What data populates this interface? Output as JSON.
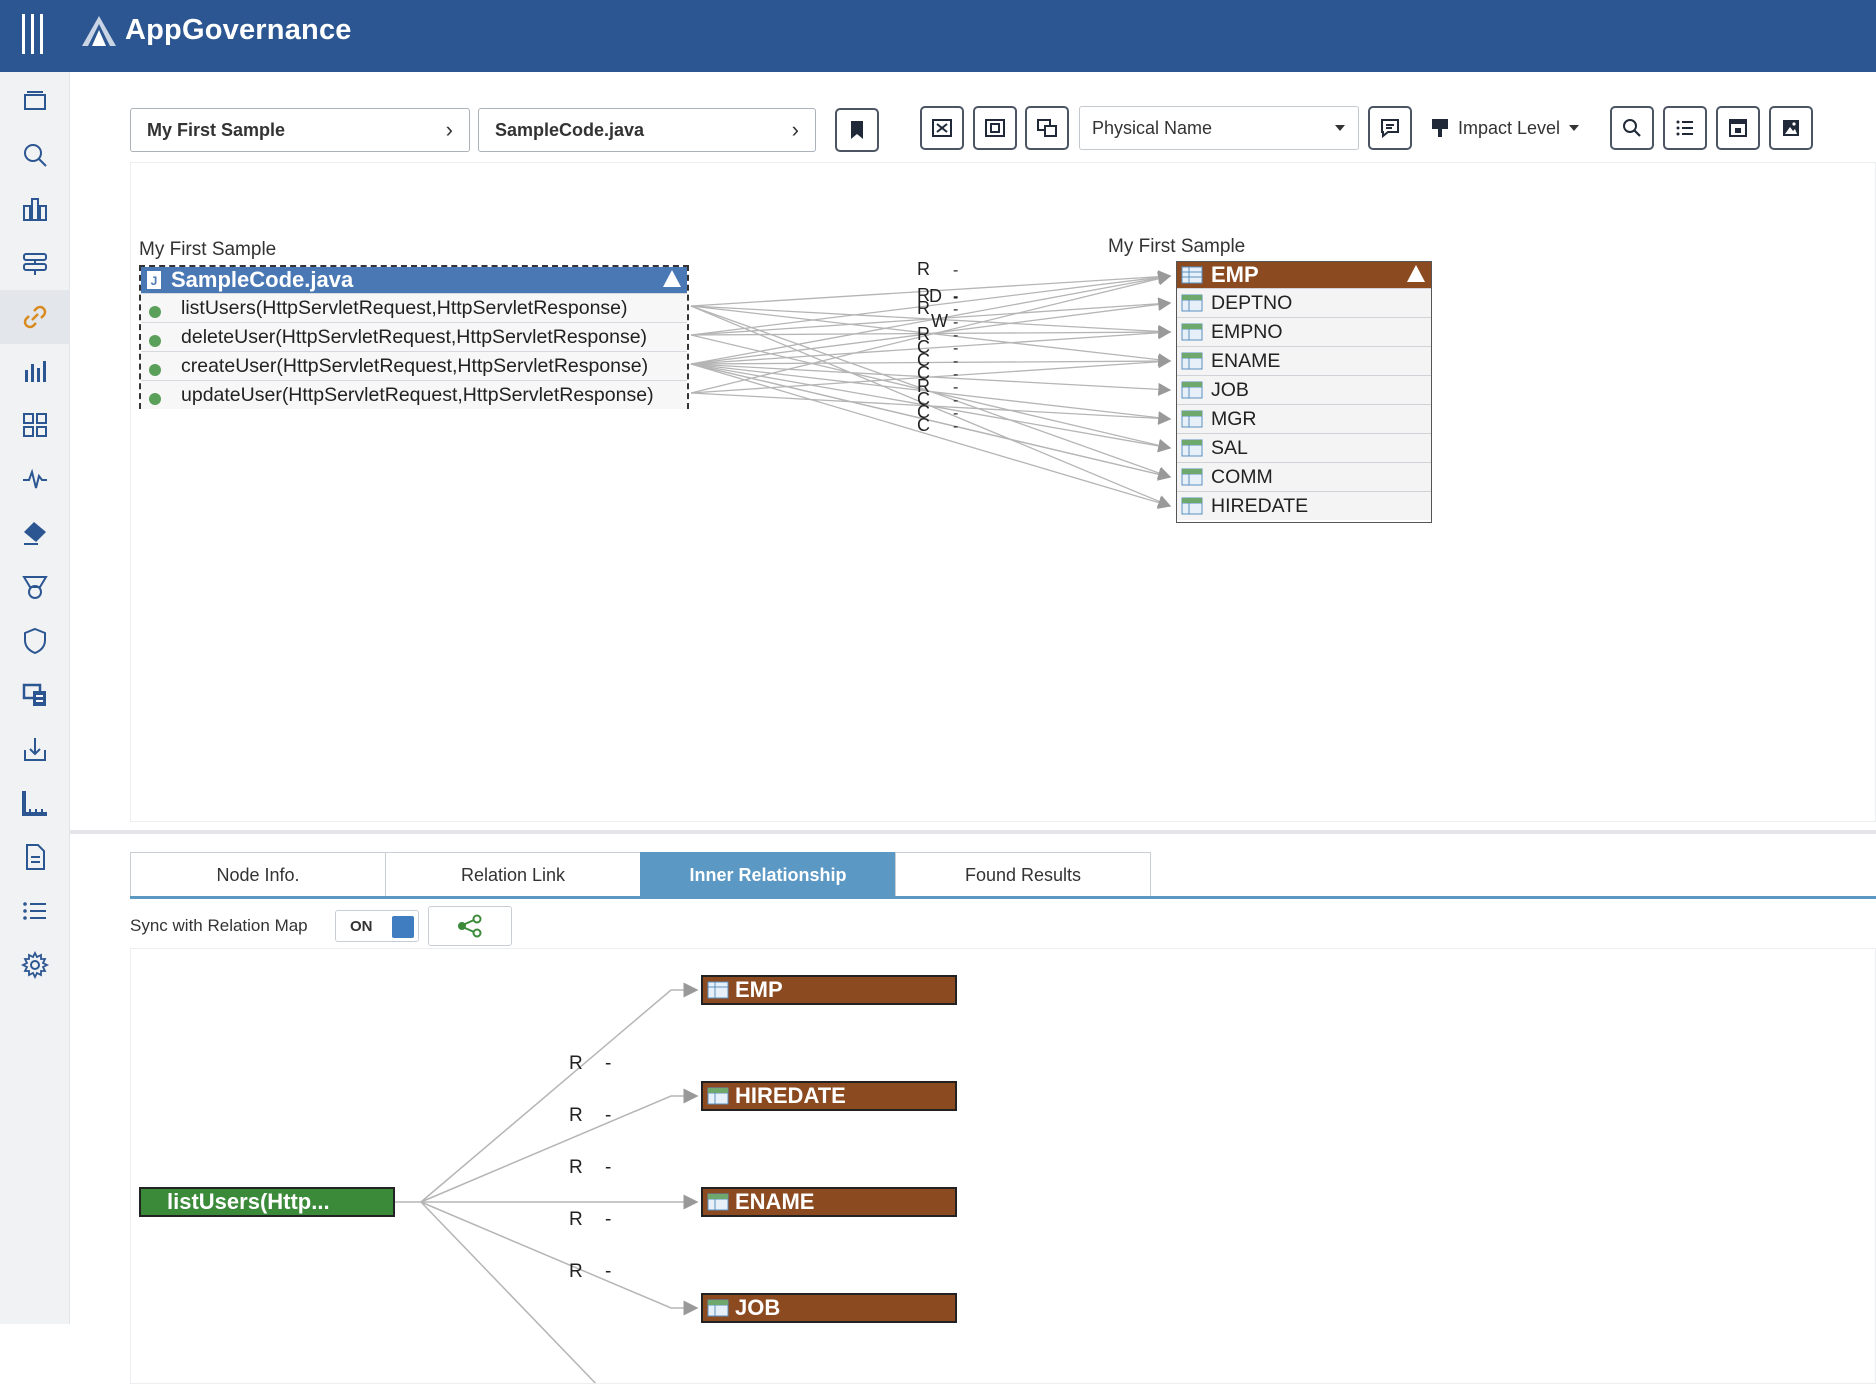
{
  "app": {
    "title": "AppGovernance",
    "brand_color": "#2c5691"
  },
  "sidebar": {
    "items": [
      {
        "icon": "layers-icon"
      },
      {
        "icon": "search-icon"
      },
      {
        "icon": "bar-columns-icon"
      },
      {
        "icon": "server-stack-icon"
      },
      {
        "icon": "link-icon",
        "active": true
      },
      {
        "icon": "bar-chart-icon"
      },
      {
        "icon": "grid-icon"
      },
      {
        "icon": "pulse-icon"
      },
      {
        "icon": "eraser-icon"
      },
      {
        "icon": "medal-icon"
      },
      {
        "icon": "shield-icon"
      },
      {
        "icon": "copy-screen-icon"
      },
      {
        "icon": "download-icon"
      },
      {
        "icon": "ruler-icon"
      },
      {
        "icon": "document-icon"
      },
      {
        "icon": "list-icon"
      },
      {
        "icon": "gear-icon"
      }
    ]
  },
  "toolbar": {
    "breadcrumb_project": "My First Sample",
    "breadcrumb_file": "SampleCode.java",
    "name_select": "Physical Name",
    "impact_level": "Impact Level"
  },
  "relation_map": {
    "left_group_label": "My First Sample",
    "right_group_label": "My First Sample",
    "java_node": {
      "title": "SampleCode.java",
      "color": "#4a78b5",
      "methods": [
        "listUsers(HttpServletRequest,HttpServletResponse)",
        "deleteUser(HttpServletRequest,HttpServletResponse)",
        "createUser(HttpServletRequest,HttpServletResponse)",
        "updateUser(HttpServletRequest,HttpServletResponse)"
      ]
    },
    "table_node": {
      "title": "EMP",
      "color": "#8b4a20",
      "columns": [
        "DEPTNO",
        "EMPNO",
        "ENAME",
        "JOB",
        "MGR",
        "SAL",
        "COMM",
        "HIREDATE"
      ]
    },
    "link_labels": [
      "R",
      "D",
      "R",
      "R",
      "W",
      "R",
      "C",
      "C",
      "C",
      "R",
      "C",
      "C",
      "C"
    ]
  },
  "tabs": [
    {
      "label": "Node Info.",
      "active": false
    },
    {
      "label": "Relation Link",
      "active": false
    },
    {
      "label": "Inner Relationship",
      "active": true
    },
    {
      "label": "Found Results",
      "active": false
    }
  ],
  "inner": {
    "sync_label": "Sync with Relation Map",
    "sync_state": "ON",
    "source_node": "listUsers(Http...",
    "source_color": "#3b8a3a",
    "targets": [
      "EMP",
      "HIREDATE",
      "ENAME",
      "JOB"
    ],
    "edge_labels": [
      {
        "access": "R",
        "dash": "-"
      },
      {
        "access": "R",
        "dash": "-"
      },
      {
        "access": "R",
        "dash": "-"
      },
      {
        "access": "R",
        "dash": "-"
      },
      {
        "access": "R",
        "dash": "-"
      }
    ]
  }
}
